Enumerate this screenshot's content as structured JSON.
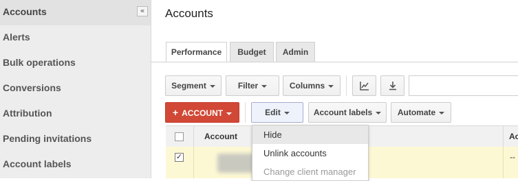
{
  "sidebar": {
    "collapse_glyph": "«",
    "items": [
      {
        "label": "Accounts"
      },
      {
        "label": "Alerts"
      },
      {
        "label": "Bulk operations"
      },
      {
        "label": "Conversions"
      },
      {
        "label": "Attribution"
      },
      {
        "label": "Pending invitations"
      },
      {
        "label": "Account labels"
      }
    ]
  },
  "main": {
    "title": "Accounts",
    "tabs": [
      {
        "label": "Performance",
        "active": true
      },
      {
        "label": "Budget"
      },
      {
        "label": "Admin"
      }
    ],
    "toolbar": {
      "segment": "Segment",
      "filter": "Filter",
      "columns": "Columns",
      "chart_icon": "line-chart-icon",
      "download_icon": "download-icon"
    },
    "actions": {
      "add_account": "ACCOUNT",
      "add_glyph": "+",
      "edit": "Edit",
      "account_labels": "Account labels",
      "automate": "Automate"
    },
    "table": {
      "headers": [
        "Account",
        "Ac"
      ],
      "row": {
        "checked": true,
        "check_glyph": "✓",
        "cell_last": "--"
      }
    },
    "edit_menu": {
      "items": [
        {
          "label": "Hide",
          "state": "hover"
        },
        {
          "label": "Unlink accounts",
          "state": "normal"
        },
        {
          "label": "Change client manager",
          "state": "disabled"
        }
      ]
    }
  },
  "colors": {
    "accent_red": "#d14836",
    "row_highlight": "#fdf8d4"
  }
}
